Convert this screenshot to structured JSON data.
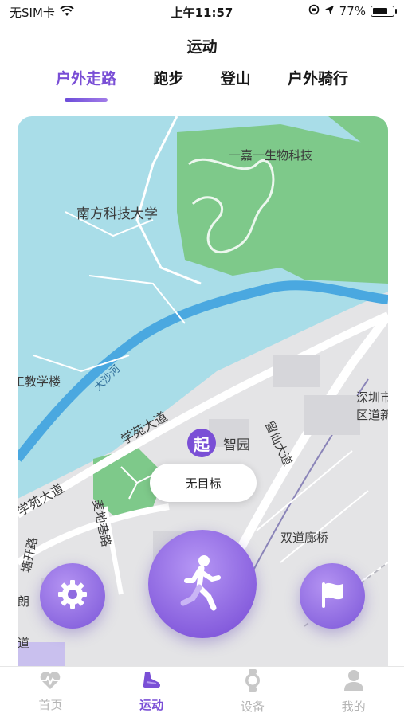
{
  "status_bar": {
    "carrier": "无SIM卡",
    "time": "上午11:57",
    "battery_text": "77%",
    "battery_level": 0.77
  },
  "header": {
    "title": "运动",
    "tabs": [
      {
        "label": "户外走路",
        "active": true
      },
      {
        "label": "跑步",
        "active": false
      },
      {
        "label": "登山",
        "active": false
      },
      {
        "label": "户外骑行",
        "active": false
      }
    ]
  },
  "map": {
    "labels": {
      "biotech": "一嘉一生物科技",
      "university": "南方科技大学",
      "teaching": "工教学楼",
      "river": "大沙河",
      "xueyuan1": "学苑大道",
      "xueyuan2": "学苑大道",
      "zhiyuan": "智园",
      "liuxian": "留仙大道",
      "maidi": "麦地巷路",
      "tangkai": "塘开路",
      "shenzhen1": "深圳市",
      "shenzhen2": "区道新",
      "bridge": "双道廊桥",
      "lang": "朗",
      "dao": "道"
    },
    "start_marker": "起",
    "goal_text": "无目标"
  },
  "tabbar": {
    "items": [
      {
        "label": "首页",
        "icon": "heart-pulse-icon",
        "active": false
      },
      {
        "label": "运动",
        "icon": "shoe-icon",
        "active": true
      },
      {
        "label": "设备",
        "icon": "watch-icon",
        "active": false
      },
      {
        "label": "我的",
        "icon": "person-icon",
        "active": false
      }
    ]
  },
  "colors": {
    "accent": "#7a4fd6",
    "map_water": "#a9dde8",
    "map_green": "#7ec98a",
    "map_urban": "#e4e4e6",
    "river": "#4aa8e0"
  }
}
